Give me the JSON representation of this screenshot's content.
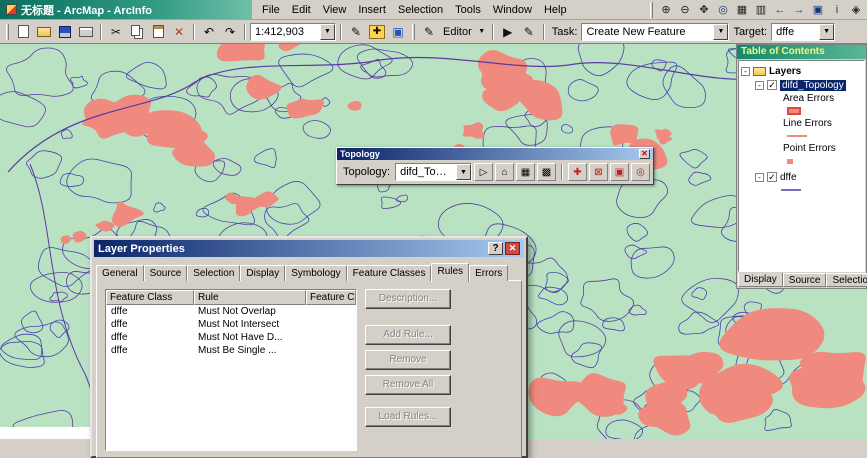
{
  "window": {
    "title": "无标题 - ArcMap - ArcInfo"
  },
  "menu": {
    "items": [
      "File",
      "Edit",
      "View",
      "Insert",
      "Selection",
      "Tools",
      "Window",
      "Help"
    ]
  },
  "toolbar": {
    "scale_value": "1:412,903",
    "editor_label": "Editor",
    "task_label": "Task:",
    "task_value": "Create New Feature",
    "target_label": "Target:",
    "target_value": "dffe"
  },
  "toc": {
    "title": "Table of Contents",
    "layers_label": "Layers",
    "topology_layer": "difd_Topology",
    "legend": [
      "Area Errors",
      "Line Errors",
      "Point Errors"
    ],
    "vector_layer": "dffe",
    "tabs": [
      "Display",
      "Source",
      "Selection"
    ]
  },
  "topology_toolbar": {
    "title": "Topology",
    "label": "Topology:",
    "value": "difd_Topology"
  },
  "layer_properties": {
    "title": "Layer Properties",
    "tabs": [
      "General",
      "Source",
      "Selection",
      "Display",
      "Symbology",
      "Feature Classes",
      "Rules",
      "Errors"
    ],
    "active_tab": "Rules",
    "columns": [
      "Feature Class",
      "Rule",
      "Feature Class"
    ],
    "rows": [
      [
        "dffe",
        "Must Not Overlap"
      ],
      [
        "dffe",
        "Must Not Intersect"
      ],
      [
        "dffe",
        "Must Not Have D..."
      ],
      [
        "dffe",
        "Must Be Single ..."
      ]
    ],
    "buttons": [
      "Description...",
      "Add Rule...",
      "Remove",
      "Remove All",
      "Load Rules..."
    ]
  },
  "colors": {
    "map_bg": "#b9e2c3",
    "error_fill": "#f0897e",
    "contour_a": "#5b3aa0",
    "contour_b": "#4343ae",
    "titlebar_teal_1": "#0b6e60",
    "titlebar_teal_2": "#6fbfa8",
    "dialog_title_1": "#0a246a",
    "dialog_title_2": "#a6caf0"
  }
}
